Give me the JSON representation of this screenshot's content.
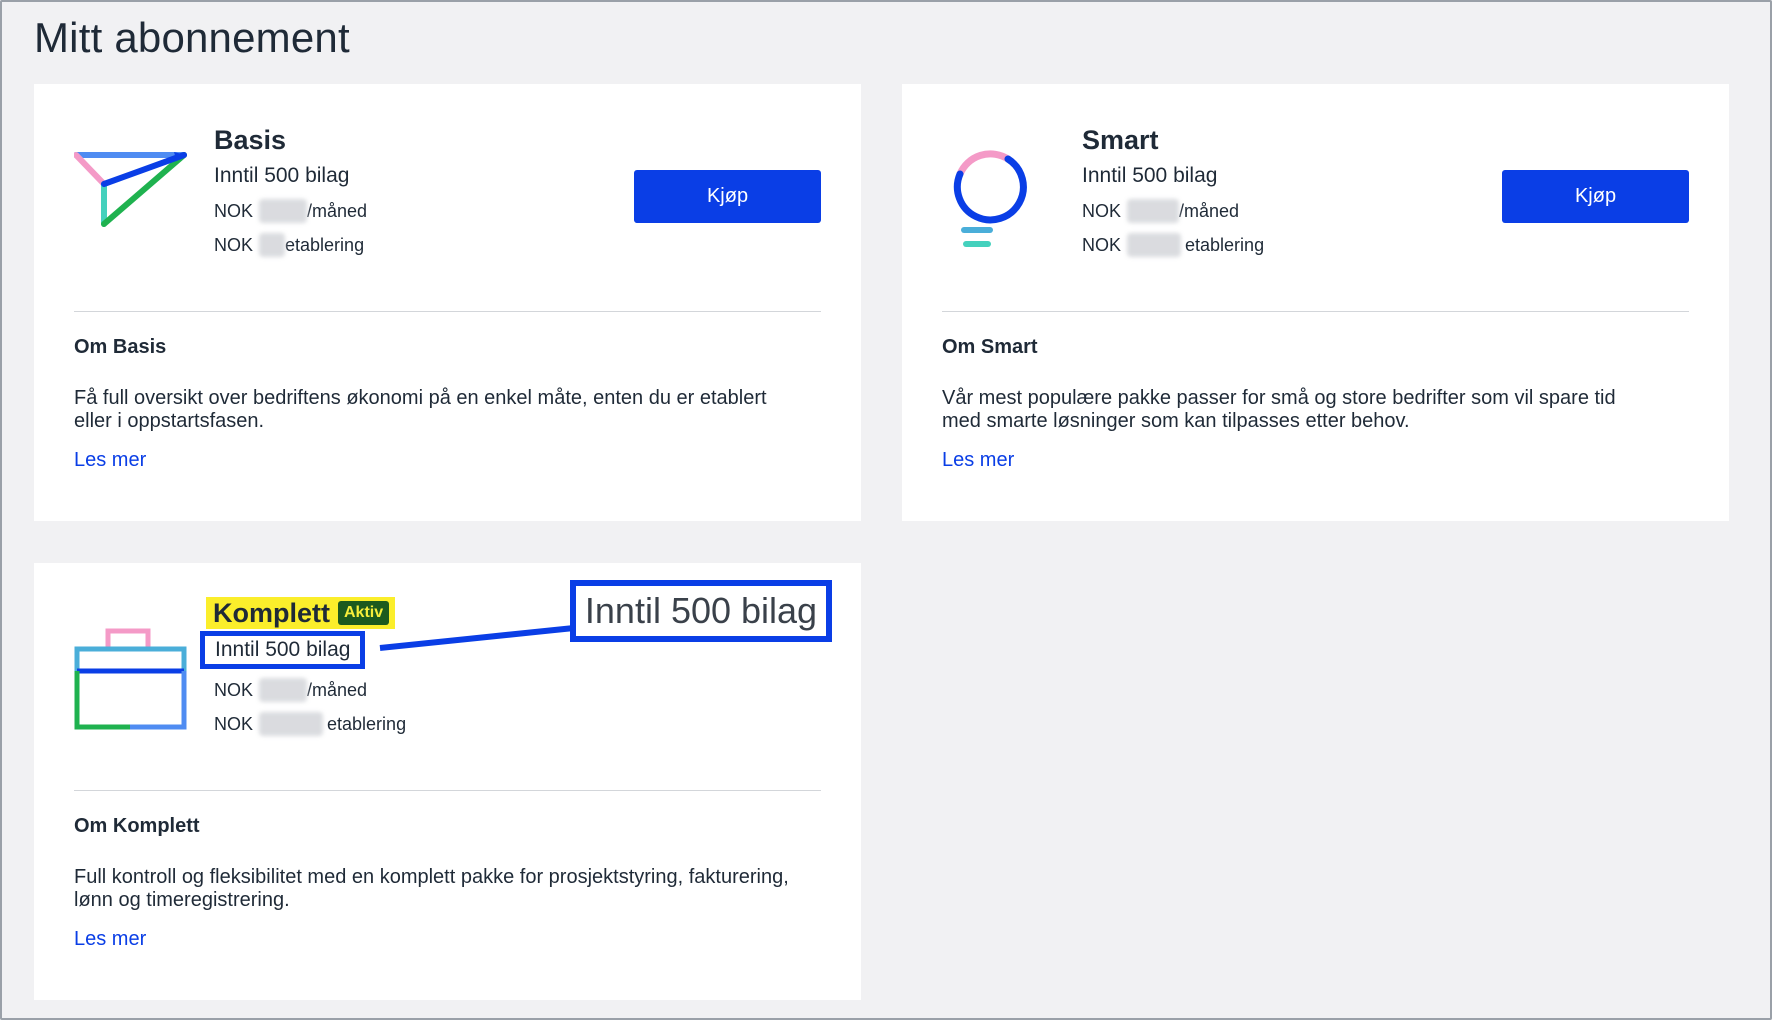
{
  "page": {
    "title": "Mitt abonnement"
  },
  "plans": [
    {
      "name": "Basis",
      "limit": "Inntil 500 bilag",
      "currency_monthly": "NOK",
      "monthly_suffix": "/måned",
      "currency_setup": "NOK",
      "setup_suffix": "etablering",
      "buy_label": "Kjøp",
      "about_title": "Om Basis",
      "about_text": "Få full oversikt over bedriftens økonomi på en enkel måte, enten du er etablert eller i oppstartsfasen.",
      "read_more": "Les mer",
      "icon": "paper-plane-icon"
    },
    {
      "name": "Smart",
      "limit": "Inntil 500 bilag",
      "currency_monthly": "NOK",
      "monthly_suffix": "/måned",
      "currency_setup": "NOK",
      "setup_suffix": "etablering",
      "buy_label": "Kjøp",
      "about_title": "Om Smart",
      "about_text": "Vår mest populære pakke passer for små og store bedrifter som vil spare tid med smarte løsninger som kan tilpasses etter behov.",
      "read_more": "Les mer",
      "icon": "lightbulb-icon"
    },
    {
      "name": "Komplett",
      "active_badge": "Aktiv",
      "limit": "Inntil 500 bilag",
      "currency_monthly": "NOK",
      "monthly_suffix": "/måned",
      "currency_setup": "NOK",
      "setup_suffix": "etablering",
      "about_title": "Om Komplett",
      "about_text": "Full kontroll og fleksibilitet med en komplett pakke for prosjektstyring, fakturering, lønn og timeregistrering.",
      "read_more": "Les mer",
      "icon": "briefcase-icon"
    }
  ],
  "callout": {
    "text": "Inntil 500 bilag"
  },
  "colors": {
    "accent": "#0a3ee6",
    "highlight": "#fbee2b",
    "badge_bg": "#1c5a1e",
    "background": "#f1f1f3"
  }
}
